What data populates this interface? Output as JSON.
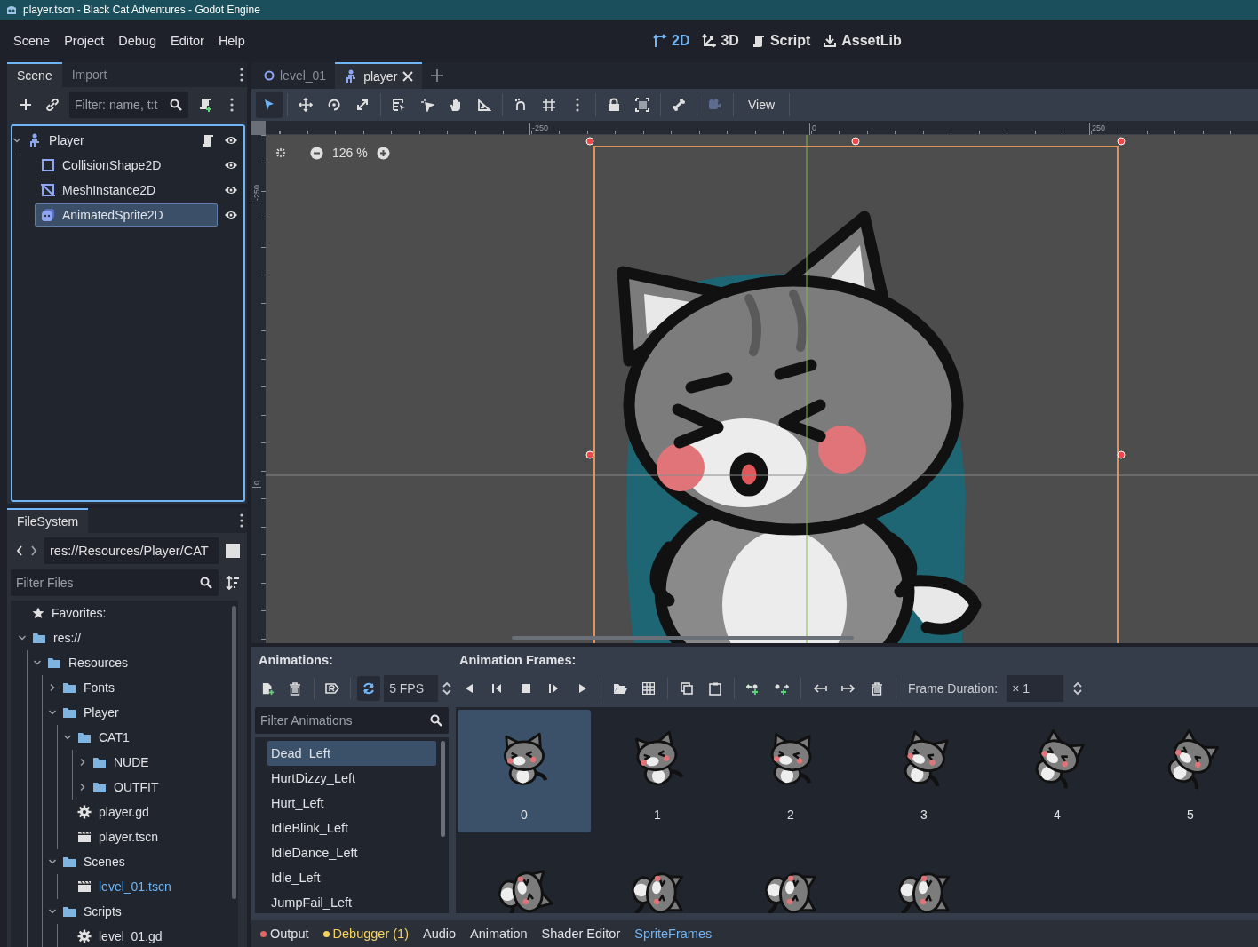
{
  "window": {
    "title": "player.tscn - Black Cat Adventures - Godot Engine"
  },
  "menu": [
    "Scene",
    "Project",
    "Debug",
    "Editor",
    "Help"
  ],
  "workspaces": [
    {
      "label": "2D",
      "kind": "canvas",
      "selected": true
    },
    {
      "label": "3D",
      "kind": "spatial",
      "selected": false
    },
    {
      "label": "Script",
      "kind": "script",
      "selected": false
    },
    {
      "label": "AssetLib",
      "kind": "assetlib",
      "selected": false
    }
  ],
  "scene_dock": {
    "tabs": [
      {
        "label": "Scene",
        "selected": true
      },
      {
        "label": "Import",
        "selected": false
      }
    ],
    "filter": {
      "placeholder": "Filter: name, t:t"
    },
    "tree": [
      {
        "label": "Player",
        "kind": "character",
        "script": true,
        "selected": false,
        "children": [
          {
            "label": "CollisionShape2D",
            "kind": "collision",
            "script": false,
            "selected": false
          },
          {
            "label": "MeshInstance2D",
            "kind": "mesh",
            "script": false,
            "selected": false
          },
          {
            "label": "AnimatedSprite2D",
            "kind": "sprite",
            "script": false,
            "selected": true
          }
        ]
      }
    ]
  },
  "filesystem": {
    "tabs": [
      {
        "label": "FileSystem",
        "selected": true
      }
    ],
    "path": "res://Resources/Player/CAT",
    "filter": {
      "placeholder": "Filter Files"
    },
    "favorites": "Favorites:",
    "tree": [
      {
        "label": "res://",
        "kind": "folder",
        "expanded": true,
        "selected": false,
        "children": [
          {
            "label": "Resources",
            "kind": "folder",
            "expanded": true,
            "selected": false,
            "children": [
              {
                "label": "Fonts",
                "kind": "folder",
                "expanded": false,
                "selected": false
              },
              {
                "label": "Player",
                "kind": "folder",
                "expanded": true,
                "selected": false,
                "children": [
                  {
                    "label": "CAT1",
                    "kind": "folder",
                    "expanded": true,
                    "selected": false,
                    "children": [
                      {
                        "label": "NUDE",
                        "kind": "folder",
                        "expanded": false,
                        "selected": false
                      },
                      {
                        "label": "OUTFIT",
                        "kind": "folder",
                        "expanded": false,
                        "selected": false
                      }
                    ]
                  },
                  {
                    "label": "player.gd",
                    "kind": "script",
                    "selected": false
                  },
                  {
                    "label": "player.tscn",
                    "kind": "scene",
                    "selected": false
                  }
                ]
              },
              {
                "label": "Scenes",
                "kind": "folder",
                "expanded": true,
                "selected": false,
                "children": [
                  {
                    "label": "level_01.tscn",
                    "kind": "scene",
                    "selected": true
                  }
                ]
              },
              {
                "label": "Scripts",
                "kind": "folder",
                "expanded": true,
                "selected": false,
                "children": [
                  {
                    "label": "level_01.gd",
                    "kind": "script",
                    "selected": false
                  }
                ]
              }
            ]
          }
        ]
      }
    ]
  },
  "editor_tabs": [
    {
      "label": "level_01",
      "kind": "scene",
      "selected": false
    },
    {
      "label": "player",
      "kind": "character",
      "selected": true
    }
  ],
  "tools": [
    {
      "kind": "select",
      "selected": true
    },
    {
      "kind": "move",
      "selected": false
    },
    {
      "kind": "rotate",
      "selected": false
    },
    {
      "kind": "scale",
      "selected": false
    },
    {
      "kind": "list",
      "selected": false
    },
    {
      "kind": "pivot",
      "selected": false
    },
    {
      "kind": "pan",
      "selected": false
    },
    {
      "kind": "ruler",
      "selected": false
    }
  ],
  "view_menu": "View",
  "viewport": {
    "zoom": "126 %",
    "top_ruler": [
      "-250",
      "0",
      "250"
    ],
    "left_ruler": [
      "-250",
      "0"
    ]
  },
  "animations": {
    "title": "Animations:",
    "loop": true,
    "fps": "5 FPS",
    "filter": {
      "placeholder": "Filter Animations"
    },
    "items": [
      {
        "label": "Dead_Left",
        "selected": true
      },
      {
        "label": "HurtDizzy_Left",
        "selected": false
      },
      {
        "label": "Hurt_Left",
        "selected": false
      },
      {
        "label": "IdleBlink_Left",
        "selected": false
      },
      {
        "label": "IdleDance_Left",
        "selected": false
      },
      {
        "label": "Idle_Left",
        "selected": false
      },
      {
        "label": "JumpFail_Left",
        "selected": false
      }
    ]
  },
  "frames": {
    "title": "Animation Frames:",
    "duration_label": "Frame Duration:",
    "duration": "× 1",
    "items": [
      {
        "label": "0",
        "selected": true
      },
      {
        "label": "1",
        "selected": false
      },
      {
        "label": "2",
        "selected": false
      },
      {
        "label": "3",
        "selected": false
      },
      {
        "label": "4",
        "selected": false
      },
      {
        "label": "5",
        "selected": false
      },
      {
        "selected": false
      },
      {
        "selected": false
      },
      {
        "selected": false
      },
      {
        "selected": false
      }
    ]
  },
  "bottom_tabs": [
    {
      "label": "Output",
      "kind": "error",
      "selected": false
    },
    {
      "label": "Debugger (1)",
      "kind": "warning",
      "selected": false
    },
    {
      "label": "Audio",
      "kind": "plain",
      "selected": false
    },
    {
      "label": "Animation",
      "kind": "plain",
      "selected": false
    },
    {
      "label": "Shader Editor",
      "kind": "plain",
      "selected": false
    },
    {
      "label": "SpriteFrames",
      "kind": "plain",
      "selected": true
    }
  ]
}
